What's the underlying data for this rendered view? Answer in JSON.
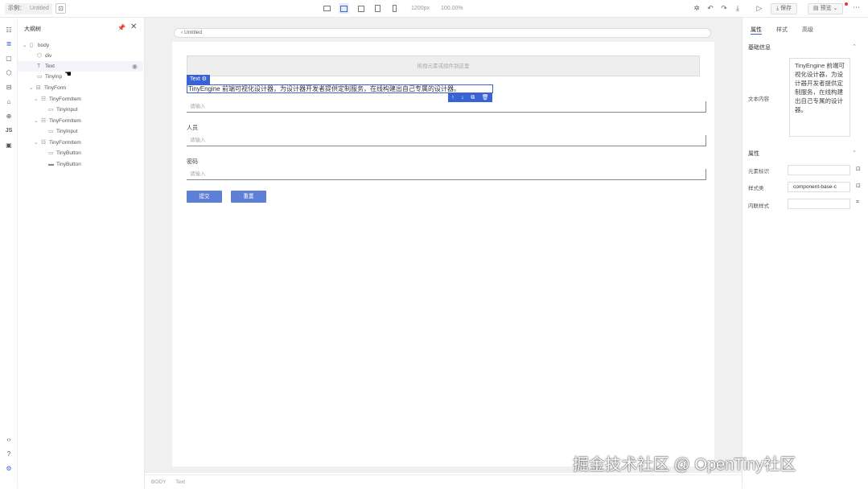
{
  "topbar": {
    "project_label": "示例：",
    "project_name": "Untitled",
    "width_readout": "1200px",
    "zoom_readout": "100.00%",
    "save_label": "保存",
    "publish_label": "预览",
    "more_glyph": "⋯"
  },
  "sidebar": {
    "title": "大纲树",
    "tree": [
      {
        "label": "body",
        "icon": "page-icon"
      },
      {
        "label": "div",
        "icon": "box-icon"
      },
      {
        "label": "Text",
        "icon": "text-icon"
      },
      {
        "label": "TinyInp",
        "icon": "input-icon"
      },
      {
        "label": "TinyForm",
        "icon": "form-icon"
      },
      {
        "label": "TinyFormItem",
        "icon": "form-item-icon"
      },
      {
        "label": "TinyInput",
        "icon": "input-icon"
      },
      {
        "label": "TinyFormItem",
        "icon": "form-item-icon"
      },
      {
        "label": "TinyInput",
        "icon": "input-icon"
      },
      {
        "label": "TinyFormItem",
        "icon": "form-item-icon"
      },
      {
        "label": "TinyButton",
        "icon": "input-icon"
      },
      {
        "label": "TinyButton",
        "icon": "button-icon"
      }
    ]
  },
  "canvas": {
    "crumb": "‹ Untitled",
    "dropzone_hint": "拖拽元素或组件到这里",
    "selected_tag": "Text ⚙",
    "selected_text": "TinyEngine 前端可视化设计器，为设计器开发者提供定制服务，在线构建出自己专属的设计器。",
    "actions": [
      "↑",
      "↓",
      "⧉",
      "🗑"
    ],
    "field1_placeholder": "请输入",
    "label2": "人员",
    "field2_placeholder": "请输入",
    "label3": "密码",
    "field3_placeholder": "请输入",
    "btn_submit": "提交",
    "btn_reset": "重置"
  },
  "status": {
    "items": [
      "BODY",
      "Text"
    ]
  },
  "right_panel": {
    "tabs": [
      "属性",
      "样式",
      "高级"
    ],
    "section_basic": "基础信息",
    "text_label": "文本内容",
    "text_value": "TinyEngine 前端可视化设计器，为设计器开发者提供定制服务，在线构建出自己专属的设计器。",
    "section_attrs": "属性",
    "attr1_label": "元素标识",
    "attr1_value": "",
    "attr2_label": "样式类",
    "attr2_value": "component-base-c",
    "attr3_label": "内联样式",
    "attr3_value": ""
  },
  "watermark": "掘金技术社区 @ OpenTiny社区"
}
